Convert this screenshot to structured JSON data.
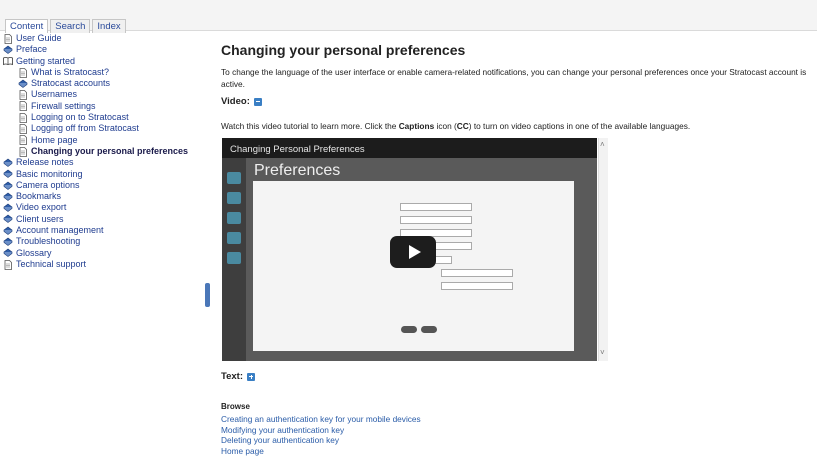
{
  "tabs": [
    {
      "label": "Content"
    },
    {
      "label": "Search"
    },
    {
      "label": "Index"
    }
  ],
  "toc": [
    {
      "label": "User Guide",
      "icon": "page-icon",
      "level": 0
    },
    {
      "label": "Preface",
      "icon": "book-closed-icon",
      "level": 0
    },
    {
      "label": "Getting started",
      "icon": "book-open-icon",
      "level": 0
    },
    {
      "label": "What is Stratocast?",
      "icon": "page-icon",
      "level": 1
    },
    {
      "label": "Stratocast accounts",
      "icon": "book-closed-icon",
      "level": 1
    },
    {
      "label": "Usernames",
      "icon": "page-icon",
      "level": 1
    },
    {
      "label": "Firewall settings",
      "icon": "page-icon",
      "level": 1
    },
    {
      "label": "Logging on to Stratocast",
      "icon": "page-icon",
      "level": 1
    },
    {
      "label": "Logging off from Stratocast",
      "icon": "page-icon",
      "level": 1
    },
    {
      "label": "Home page",
      "icon": "page-icon",
      "level": 1
    },
    {
      "label": "Changing your personal preferences",
      "icon": "page-icon",
      "level": 1,
      "selected": true
    },
    {
      "label": "Release notes",
      "icon": "book-closed-icon",
      "level": 0
    },
    {
      "label": "Basic monitoring",
      "icon": "book-closed-icon",
      "level": 0
    },
    {
      "label": "Camera options",
      "icon": "book-closed-icon",
      "level": 0
    },
    {
      "label": "Bookmarks",
      "icon": "book-closed-icon",
      "level": 0
    },
    {
      "label": "Video export",
      "icon": "book-closed-icon",
      "level": 0
    },
    {
      "label": "Client users",
      "icon": "book-closed-icon",
      "level": 0
    },
    {
      "label": "Account management",
      "icon": "book-closed-icon",
      "level": 0
    },
    {
      "label": "Troubleshooting",
      "icon": "book-closed-icon",
      "level": 0
    },
    {
      "label": "Glossary",
      "icon": "book-closed-icon",
      "level": 0
    },
    {
      "label": "Technical support",
      "icon": "page-icon",
      "level": 0
    }
  ],
  "article": {
    "title": "Changing your personal preferences",
    "intro": "To change the language of the user interface or enable camera-related notifications, you can change your personal preferences once your Stratocast account is active.",
    "video_heading": "Video:",
    "watch_prefix": "Watch this video tutorial to learn more. Click the ",
    "watch_captions": "Captions",
    "watch_mid": " icon (",
    "watch_cc": "CC",
    "watch_suffix": ") to turn on video captions in one of the available languages.",
    "video_title": "Changing Personal Preferences",
    "video_screen_heading": "Preferences",
    "text_heading": "Text:",
    "browse_label": "Browse",
    "browse_links": [
      "Creating an authentication key for your mobile devices",
      "Modifying your authentication key",
      "Deleting your authentication key",
      "Home page"
    ]
  },
  "colors": {
    "link": "#2a5ca8",
    "toc_link": "#1f3c8f",
    "accent": "#3a7fc4"
  }
}
